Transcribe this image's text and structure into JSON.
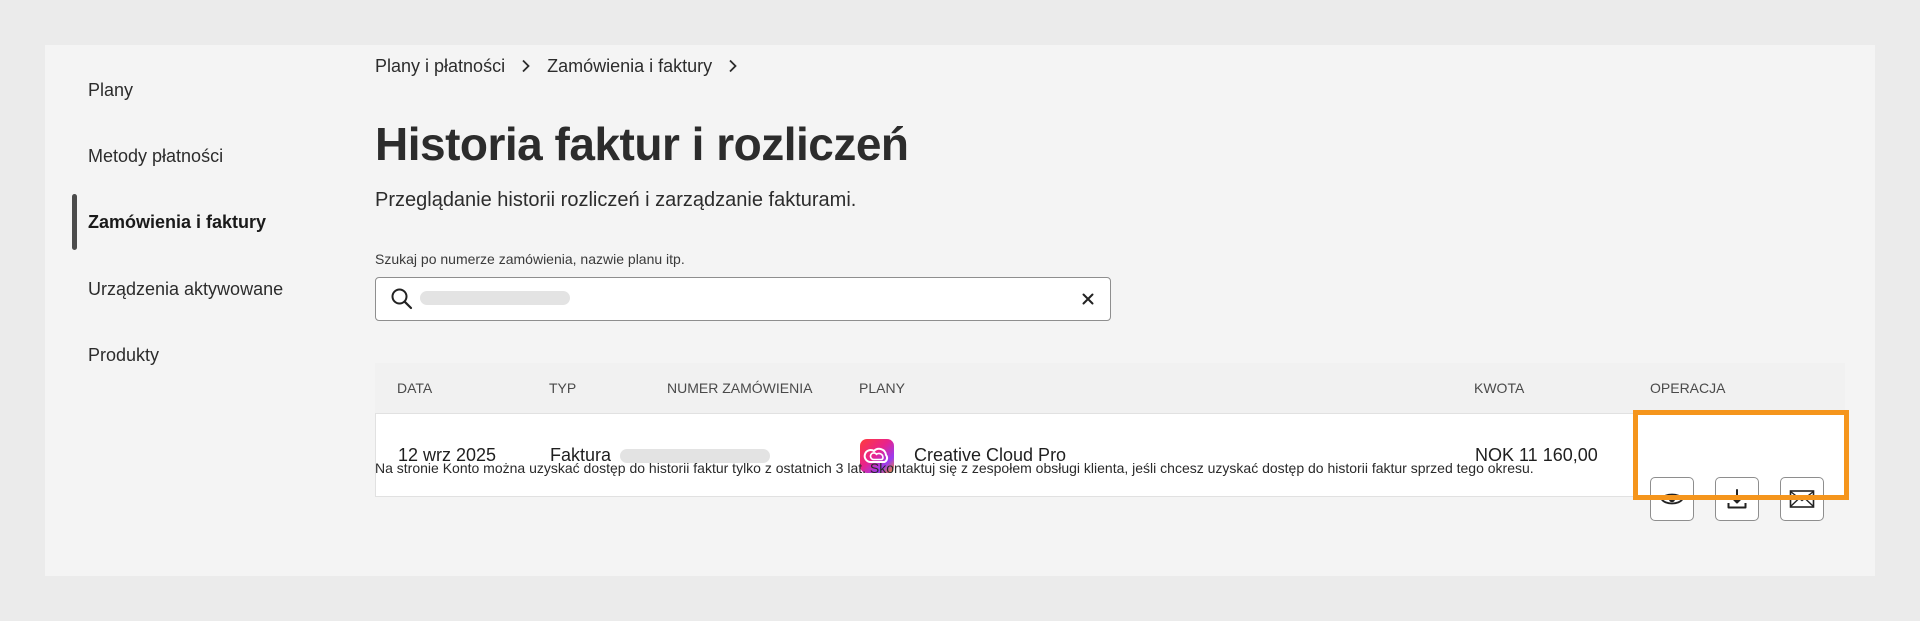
{
  "sidebar": {
    "items": [
      {
        "label": "Plany",
        "active": false
      },
      {
        "label": "Metody płatności",
        "active": false
      },
      {
        "label": "Zamówienia i faktury",
        "active": true
      },
      {
        "label": "Urządzenia aktywowane",
        "active": false
      },
      {
        "label": "Produkty",
        "active": false
      }
    ]
  },
  "breadcrumb": {
    "items": [
      "Plany i płatności",
      "Zamówienia i faktury"
    ]
  },
  "page": {
    "title": "Historia faktur i rozliczeń",
    "subtitle": "Przeglądanie historii rozliczeń i zarządzanie fakturami."
  },
  "search": {
    "label": "Szukaj po numerze zamówienia, nazwie planu itp.",
    "value": "",
    "clear_icon": "close-icon"
  },
  "table": {
    "headers": [
      "Data",
      "Typ",
      "Numer zamówienia",
      "Plany",
      "Kwota",
      "Operacja"
    ],
    "rows": [
      {
        "date": "12 wrz 2025",
        "type": "Faktura",
        "order_number": "",
        "plan": "Creative Cloud Pro",
        "plan_icon": "creative-cloud-icon",
        "amount": "NOK 11 160,00",
        "operations": [
          "eye-icon",
          "download-icon",
          "mail-icon"
        ]
      }
    ]
  },
  "footnote": "Na stronie Konto można uzyskać dostęp do historii faktur tylko z ostatnich 3 lat. Skontaktuj się z zespołem obsługi klienta, jeśli chcesz uzyskać dostęp do historii faktur sprzed tego okresu.",
  "colors": {
    "highlight": "#f5951c",
    "background": "#ebebeb",
    "card": "#f4f4f4"
  }
}
